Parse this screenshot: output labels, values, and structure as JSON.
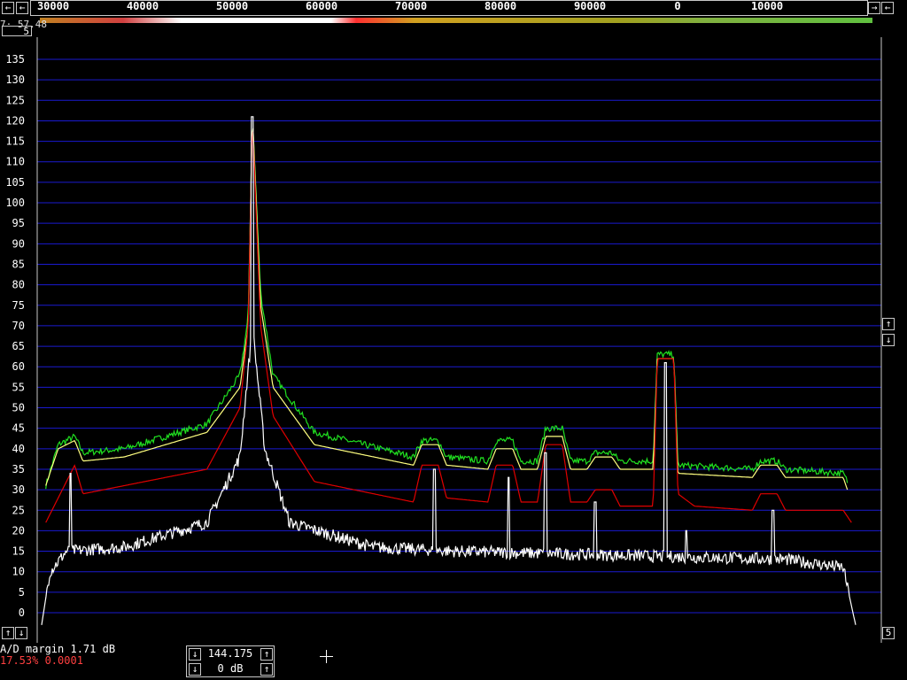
{
  "top_bar": {
    "left_button": "←",
    "right_button_1": "→",
    "right_button_2": "←",
    "freq_labels": [
      "30000",
      "40000",
      "50000",
      "60000",
      "70000",
      "80000",
      "90000",
      "0",
      "10000"
    ]
  },
  "marker": {
    "readout": "7· 57.48",
    "box_value": "5"
  },
  "side_buttons": {
    "up": "↑",
    "down": "↓",
    "bottom_left_up": "↑",
    "bottom_left_down": "↓",
    "bottom_right": "5"
  },
  "status": {
    "ad_margin": "A/D margin  1.71 dB",
    "percent": "17.53% 0.0001"
  },
  "center_box": {
    "frequency": "144.175",
    "gain": "0 dB",
    "up": "↑",
    "down": "↓"
  },
  "colors": {
    "grid": "#1a1ad0",
    "white_trace": "#ffffff",
    "red_trace": "#e00000",
    "yellow_trace": "#ffff80",
    "green_trace": "#20e020"
  },
  "chart_data": {
    "type": "line",
    "y_ticks": [
      135,
      130,
      125,
      120,
      115,
      110,
      105,
      100,
      95,
      90,
      85,
      80,
      75,
      70,
      65,
      60,
      55,
      50,
      45,
      40,
      35,
      30,
      25,
      20,
      15,
      10,
      5,
      0
    ],
    "ylim": [
      -3,
      139
    ],
    "xlim": [
      0,
      1
    ],
    "grid": true,
    "series": [
      {
        "color": "white",
        "peaks": [
          [
            0.035,
            34
          ],
          [
            0.255,
            121
          ],
          [
            0.475,
            35
          ],
          [
            0.565,
            33
          ],
          [
            0.61,
            39
          ],
          [
            0.67,
            27
          ],
          [
            0.755,
            61
          ],
          [
            0.78,
            20
          ],
          [
            0.885,
            25
          ]
        ],
        "floor": [
          [
            0.0,
            -3
          ],
          [
            0.01,
            10
          ],
          [
            0.03,
            15
          ],
          [
            0.1,
            16
          ],
          [
            0.2,
            22
          ],
          [
            0.24,
            38
          ],
          [
            0.255,
            70
          ],
          [
            0.27,
            40
          ],
          [
            0.3,
            22
          ],
          [
            0.4,
            16
          ],
          [
            0.5,
            15
          ],
          [
            0.7,
            14
          ],
          [
            0.9,
            13
          ],
          [
            0.97,
            11
          ],
          [
            0.985,
            -3
          ]
        ]
      },
      {
        "color": "red",
        "points": [
          [
            0.005,
            22
          ],
          [
            0.04,
            36
          ],
          [
            0.05,
            29
          ],
          [
            0.2,
            35
          ],
          [
            0.24,
            50
          ],
          [
            0.25,
            70
          ],
          [
            0.255,
            121
          ],
          [
            0.265,
            70
          ],
          [
            0.28,
            48
          ],
          [
            0.33,
            32
          ],
          [
            0.45,
            27
          ],
          [
            0.46,
            36
          ],
          [
            0.48,
            36
          ],
          [
            0.49,
            28
          ],
          [
            0.54,
            27
          ],
          [
            0.55,
            36
          ],
          [
            0.57,
            36
          ],
          [
            0.58,
            27
          ],
          [
            0.6,
            27
          ],
          [
            0.61,
            41
          ],
          [
            0.63,
            41
          ],
          [
            0.64,
            27
          ],
          [
            0.66,
            27
          ],
          [
            0.67,
            30
          ],
          [
            0.69,
            30
          ],
          [
            0.7,
            26
          ],
          [
            0.74,
            26
          ],
          [
            0.745,
            62
          ],
          [
            0.765,
            62
          ],
          [
            0.77,
            29
          ],
          [
            0.79,
            26
          ],
          [
            0.86,
            25
          ],
          [
            0.87,
            29
          ],
          [
            0.89,
            29
          ],
          [
            0.9,
            25
          ],
          [
            0.97,
            25
          ],
          [
            0.98,
            22
          ]
        ]
      },
      {
        "color": "yellow",
        "points": [
          [
            0.005,
            31
          ],
          [
            0.02,
            40
          ],
          [
            0.04,
            42
          ],
          [
            0.05,
            37
          ],
          [
            0.1,
            38
          ],
          [
            0.2,
            44
          ],
          [
            0.24,
            55
          ],
          [
            0.25,
            70
          ],
          [
            0.255,
            122
          ],
          [
            0.265,
            75
          ],
          [
            0.28,
            55
          ],
          [
            0.33,
            41
          ],
          [
            0.45,
            36
          ],
          [
            0.46,
            41
          ],
          [
            0.48,
            41
          ],
          [
            0.49,
            36
          ],
          [
            0.54,
            35
          ],
          [
            0.55,
            40
          ],
          [
            0.57,
            40
          ],
          [
            0.58,
            35
          ],
          [
            0.6,
            35
          ],
          [
            0.61,
            43
          ],
          [
            0.63,
            43
          ],
          [
            0.64,
            35
          ],
          [
            0.66,
            35
          ],
          [
            0.67,
            38
          ],
          [
            0.69,
            38
          ],
          [
            0.7,
            35
          ],
          [
            0.74,
            35
          ],
          [
            0.745,
            62
          ],
          [
            0.765,
            62
          ],
          [
            0.77,
            34
          ],
          [
            0.86,
            33
          ],
          [
            0.87,
            36
          ],
          [
            0.89,
            36
          ],
          [
            0.9,
            33
          ],
          [
            0.97,
            33
          ],
          [
            0.975,
            30
          ]
        ]
      },
      {
        "color": "green",
        "points": [
          [
            0.005,
            31
          ],
          [
            0.02,
            41
          ],
          [
            0.04,
            43
          ],
          [
            0.05,
            39
          ],
          [
            0.1,
            40
          ],
          [
            0.2,
            46
          ],
          [
            0.24,
            58
          ],
          [
            0.25,
            72
          ],
          [
            0.255,
            122
          ],
          [
            0.265,
            78
          ],
          [
            0.28,
            58
          ],
          [
            0.33,
            44
          ],
          [
            0.45,
            38
          ],
          [
            0.46,
            42
          ],
          [
            0.48,
            42
          ],
          [
            0.49,
            38
          ],
          [
            0.54,
            37
          ],
          [
            0.55,
            42
          ],
          [
            0.57,
            42
          ],
          [
            0.58,
            37
          ],
          [
            0.6,
            37
          ],
          [
            0.61,
            45
          ],
          [
            0.63,
            45
          ],
          [
            0.64,
            37
          ],
          [
            0.66,
            37
          ],
          [
            0.67,
            39
          ],
          [
            0.69,
            39
          ],
          [
            0.7,
            37
          ],
          [
            0.74,
            37
          ],
          [
            0.745,
            63
          ],
          [
            0.765,
            63
          ],
          [
            0.77,
            36
          ],
          [
            0.86,
            35
          ],
          [
            0.87,
            37
          ],
          [
            0.89,
            37
          ],
          [
            0.9,
            35
          ],
          [
            0.97,
            34
          ],
          [
            0.975,
            32
          ]
        ]
      }
    ]
  }
}
